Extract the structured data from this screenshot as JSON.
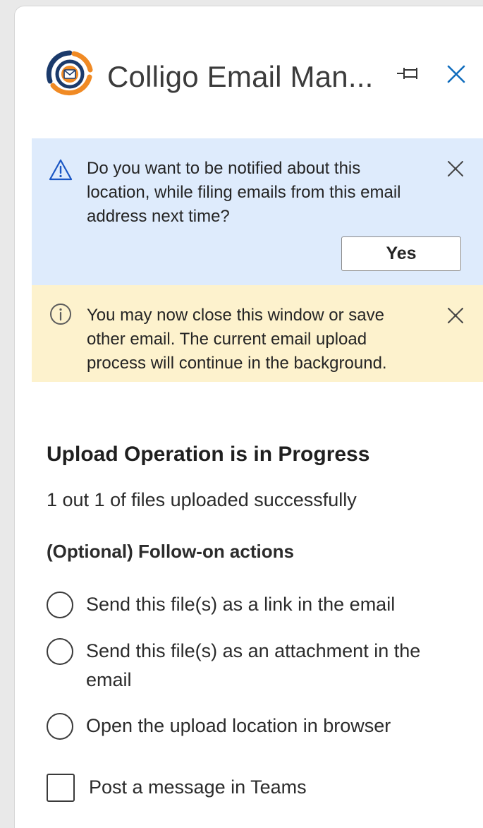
{
  "header": {
    "title": "Colligo Email Man...",
    "logo_icon": "colligo-logo-icon",
    "pin_icon": "pin-icon",
    "close_icon": "close-icon"
  },
  "notify_banner": {
    "icon": "warning-icon",
    "text": "Do you want to be notified about this location, while filing emails from this email address next time?",
    "yes_label": "Yes",
    "close_icon": "close-icon",
    "background": "#deebfc"
  },
  "info_banner": {
    "icon": "info-icon",
    "text": "You may now close this window or save other email. The current email upload process will continue in the background.",
    "close_icon": "close-icon",
    "background": "#fdf2cd"
  },
  "main": {
    "heading": "Upload Operation is in Progress",
    "status": "1 out 1 of files uploaded successfully",
    "followon_heading": "(Optional) Follow-on actions",
    "radio_options": [
      {
        "label": "Send this file(s) as a link in the email",
        "selected": false
      },
      {
        "label": "Send this file(s) as an attachment in the email",
        "selected": false
      },
      {
        "label": "Open the upload location in browser",
        "selected": false
      }
    ],
    "checkbox_option": {
      "label": "Post a message in Teams",
      "checked": false
    }
  },
  "colors": {
    "accent_blue": "#0f6cbd",
    "logo_orange": "#f08a24",
    "logo_navy": "#1b3a6b"
  }
}
